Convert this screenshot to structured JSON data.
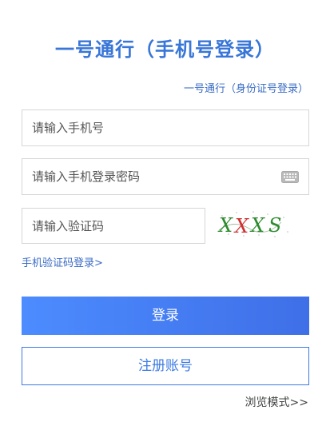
{
  "header": {
    "title": "一号通行（手机号登录）",
    "alt_login_link": "一号通行（身份证号登录）"
  },
  "form": {
    "phone_placeholder": "请输入手机号",
    "phone_value": "",
    "password_placeholder": "请输入手机登录密码",
    "password_value": "",
    "captcha_placeholder": "请输入验证码",
    "captcha_value": "",
    "captcha_image_text": "XXXS"
  },
  "links": {
    "sms_login": "手机验证码登录>",
    "browse_mode": "浏览模式>>"
  },
  "buttons": {
    "login": "登录",
    "register": "注册账号"
  },
  "icons": {
    "keyboard": "keyboard-icon",
    "captcha": "captcha-image"
  },
  "colors": {
    "title": "#3876d8",
    "link": "#3a6cc4",
    "login_gradient_start": "#4c8cff",
    "login_gradient_end": "#3f6fe8",
    "register_border": "#3d7be3",
    "register_text": "#3d7be3",
    "input_border": "#d6d6d6",
    "captcha_green": "#2e8b2e",
    "captcha_red": "#d03030"
  }
}
